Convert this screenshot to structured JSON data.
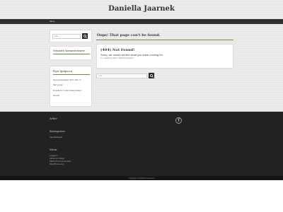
{
  "site": {
    "title": "Daniella Jaarnek"
  },
  "menu": {
    "label": "Meny"
  },
  "sidebar": {
    "search_placeholder": "Sök ...",
    "recent_comments_title": "Senaste kommentarer",
    "recent_posts_title": "Nya hjälpa ni",
    "recent_posts": [
      "Nyinvesteradelet SUb mdk \"1\"",
      "Mer ipsum",
      "Dossitet it b vilar Inkorporation",
      "Hemal"
    ]
  },
  "main": {
    "heading": "Oops! That page can't be found.",
    "box_title": "(404) Not Found!",
    "box_message": "Sorry, we could not find what you were looking for.",
    "box_tip": "Try searching with a different keyword.",
    "search_placeholder": "Sök ..."
  },
  "footer": {
    "archive_title": "Arkiv",
    "categories_title": "Kategorier",
    "category_item": "Ingenkategori",
    "meta_title": "Meta",
    "meta_links": [
      "Logga in",
      "Flöde för inlägg",
      "Flöde för kommentarer",
      "WordPress.org"
    ],
    "social_icon": "facebook-icon",
    "copyright": "Copyright © All Rights Reserved"
  },
  "colors": {
    "accent": "#5f8f3b",
    "header_bar": "#2f2f2f",
    "footer_bg": "#222222"
  }
}
